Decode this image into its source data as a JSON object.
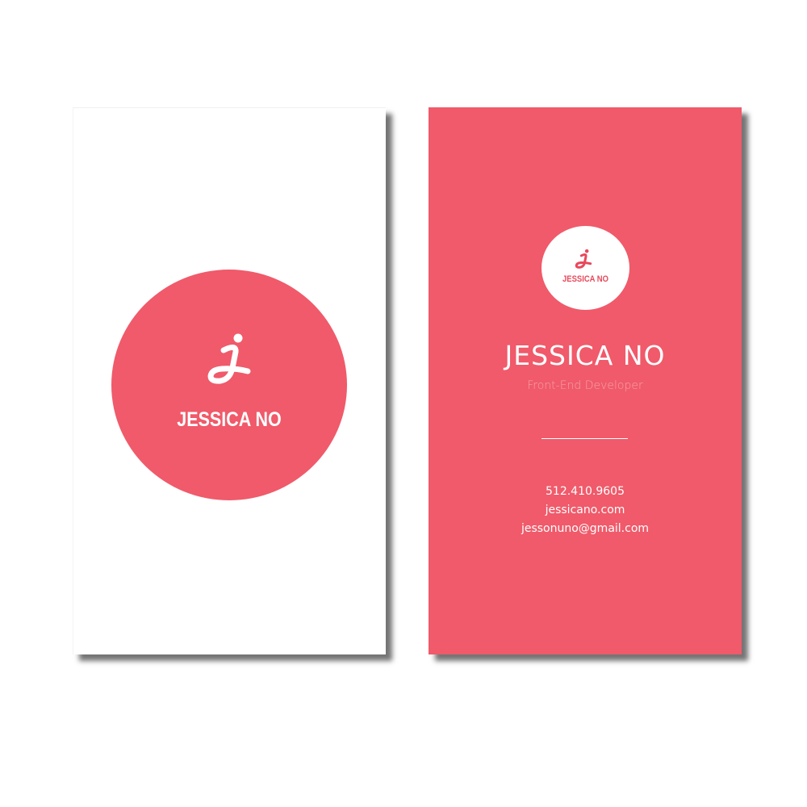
{
  "colors": {
    "accent": "#f05a6a",
    "background": "#ffffff",
    "muted_text": "#f7a0a9"
  },
  "front_card": {
    "logo_icon": "cursive-j-monogram",
    "name": "JESSICA NO"
  },
  "back_card": {
    "logo_icon": "cursive-j-monogram",
    "circle_name": "JESSICA NO",
    "name": "JESSICA NO",
    "title": "Front-End Developer",
    "phone": "512.410.9605",
    "website": "jessicano.com",
    "email": "jessonuno@gmail.com"
  }
}
